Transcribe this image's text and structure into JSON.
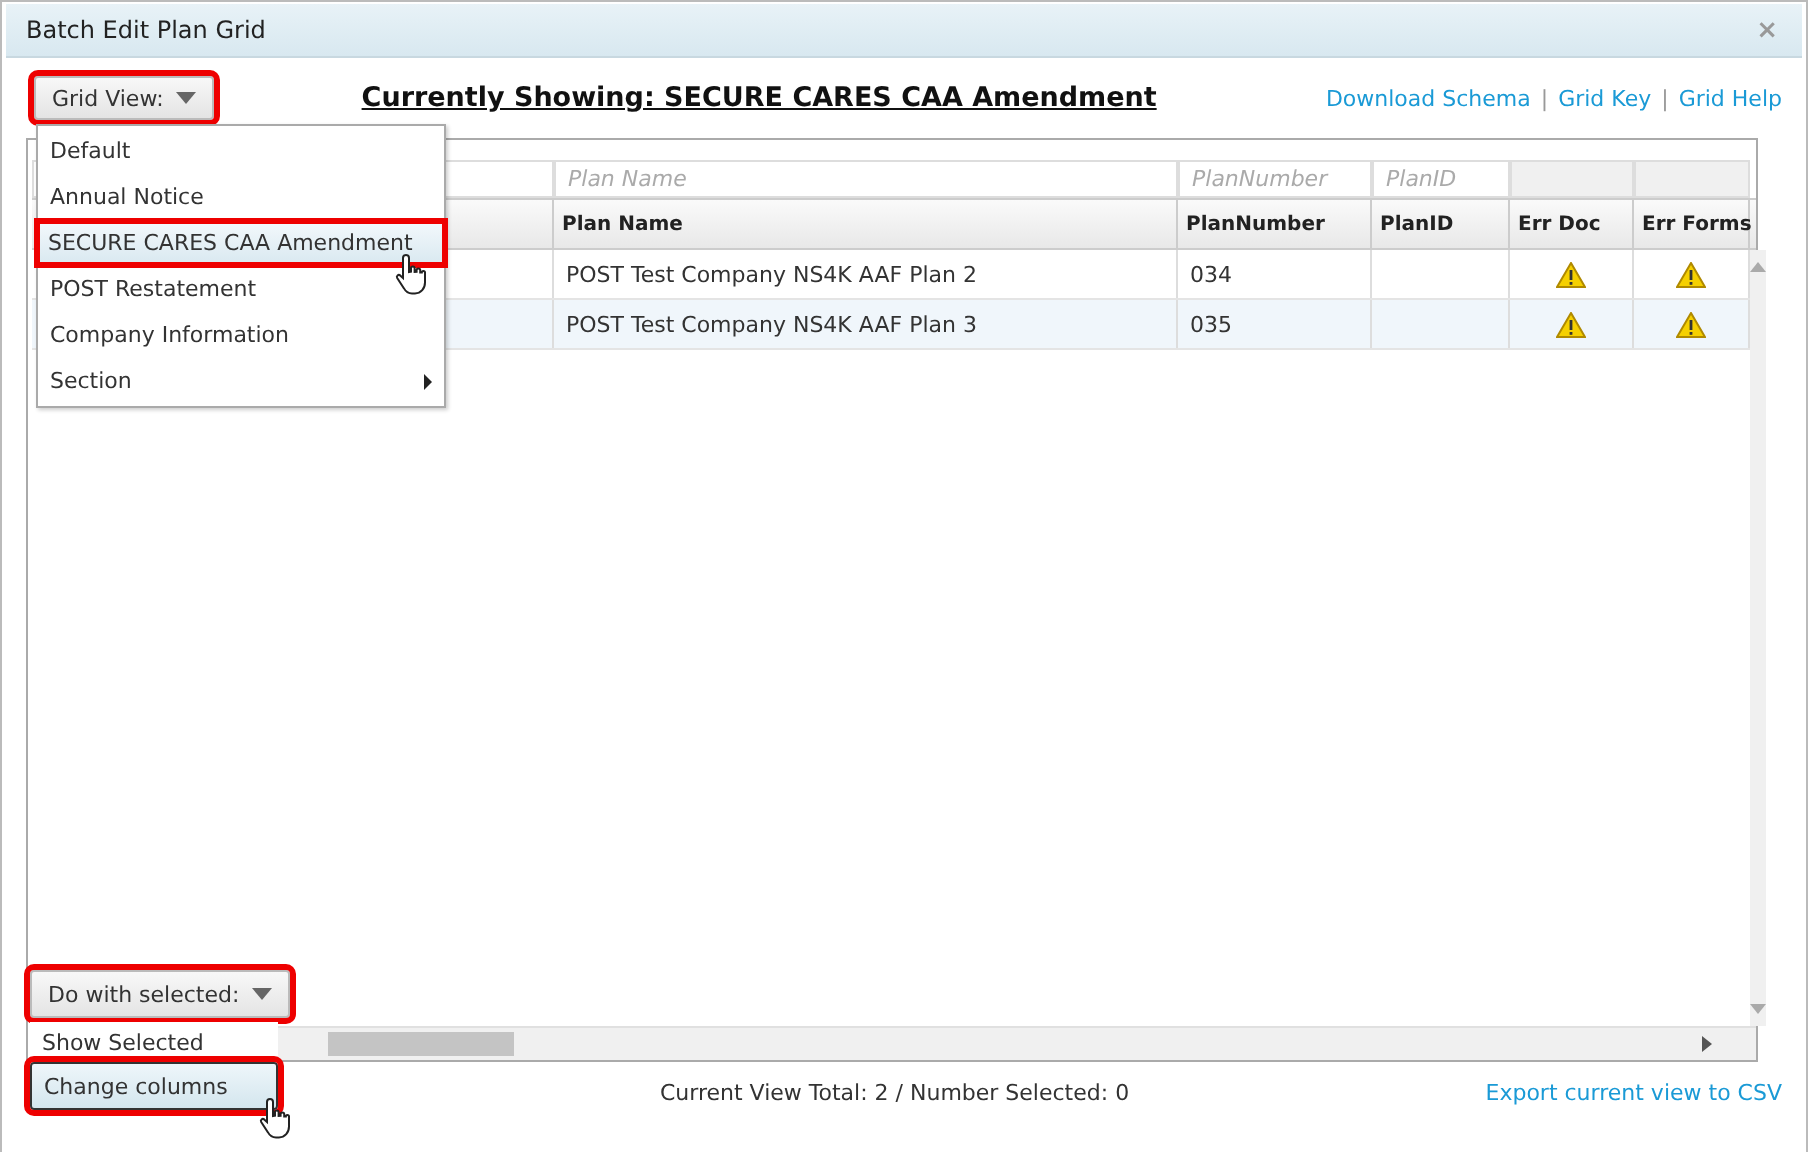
{
  "window": {
    "title": "Batch Edit Plan Grid",
    "close": "×"
  },
  "grid_view_button": {
    "label": "Grid View:",
    "highlighted": true
  },
  "heading": "Currently Showing: SECURE CARES CAA Amendment",
  "header_links": [
    {
      "kind": "link",
      "text": "Download Schema"
    },
    {
      "kind": "separator",
      "text": "|"
    },
    {
      "kind": "link",
      "text": "Grid Key"
    },
    {
      "kind": "separator",
      "text": "|"
    },
    {
      "kind": "link",
      "text": "Grid Help"
    }
  ],
  "grid_view_menu": [
    {
      "label": "Default",
      "highlighted": false,
      "submenu": false
    },
    {
      "label": "Annual Notice",
      "highlighted": false,
      "submenu": false
    },
    {
      "label": "SECURE CARES CAA Amendment",
      "highlighted": true,
      "submenu": false
    },
    {
      "label": "POST Restatement",
      "highlighted": false,
      "submenu": false
    },
    {
      "label": "Company Information",
      "highlighted": false,
      "submenu": false
    },
    {
      "label": "Section",
      "highlighted": false,
      "submenu": true
    }
  ],
  "table": {
    "filters": [
      "Plan Name",
      "PlanNumber",
      "PlanID"
    ],
    "columns": [
      "Plan Name",
      "PlanNumber",
      "PlanID",
      "Err Doc",
      "Err Forms"
    ],
    "rows": [
      {
        "plan_name": "POST Test Company NS4K AAF Plan 2",
        "plan_number": "034",
        "err_doc": true,
        "err_forms": true,
        "shaded": false
      },
      {
        "plan_name": "POST Test Company NS4K AAF Plan 3",
        "plan_number": "035",
        "err_doc": true,
        "err_forms": true,
        "shaded": true
      }
    ]
  },
  "do_with_selected_button": {
    "label": "Do with selected:",
    "highlighted": true
  },
  "do_with_selected_menu": [
    {
      "label": "Show Selected",
      "highlighted": false
    },
    {
      "label": "Change columns",
      "highlighted": true
    }
  ],
  "status": "Current View Total: 2 / Number Selected: 0",
  "export_link": "Export current view to CSV"
}
